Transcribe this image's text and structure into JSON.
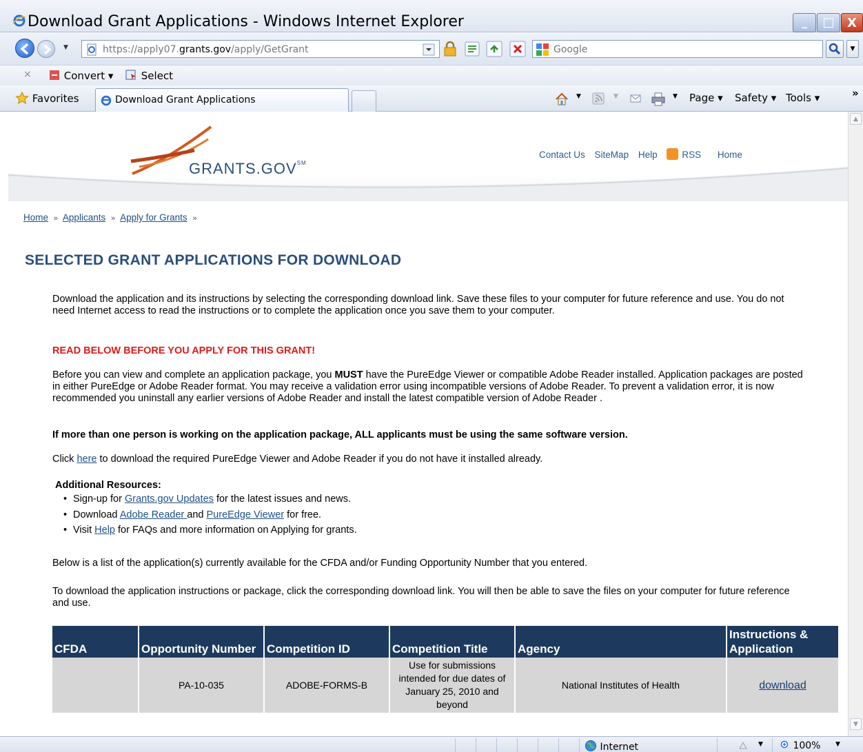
{
  "window": {
    "title": "Download Grant Applications - Windows Internet Explorer",
    "min_label": "_",
    "max_label": "□",
    "close_label": "X"
  },
  "address": {
    "url_prefix": "https://apply07.",
    "url_domain": "grants.gov",
    "url_path": "/apply/GetGrant",
    "search_placeholder": "Google"
  },
  "command_bar": {
    "close_label": "×",
    "convert_label": "Convert ▾",
    "select_label": "Select"
  },
  "favorites_bar": {
    "favorites_label": "Favorites",
    "tab_label": "Download Grant Applications",
    "page_menu": "Page ▾",
    "safety_menu": "Safety ▾",
    "tools_menu": "Tools ▾",
    "overflow": "»"
  },
  "site": {
    "logo_text": "GRANTS.GOV",
    "logo_sm": "SM",
    "top_links": [
      "Contact Us",
      "SiteMap",
      "Help",
      "RSS",
      "Home"
    ],
    "breadcrumb": [
      "Home",
      "Applicants",
      "Apply for Grants"
    ],
    "breadcrumb_sep": "»",
    "page_title": "SELECTED GRANT APPLICATIONS FOR DOWNLOAD"
  },
  "content": {
    "intro": "Download the application and its instructions by selecting the corresponding download link. Save these files to your computer for future reference and use. You do not need Internet access to read the instructions or to complete the application once you save them to your computer.",
    "warning": "READ BELOW BEFORE YOU APPLY FOR THIS GRANT!",
    "before_1": "Before you can view and complete an application package, you ",
    "before_must": "MUST",
    "before_2": " have the PureEdge Viewer or compatible Adobe Reader installed. Application packages are posted in either PureEdge or Adobe Reader format. You may receive a validation error using incompatible versions of Adobe Reader. To prevent a validation error, it is now recommended you uninstall any earlier versions of Adobe Reader and install the latest compatible version of Adobe Reader .",
    "bold_note": "If more than one person is working on the application package, ALL applicants must be using the same software version.",
    "click_1": "Click ",
    "click_link": "here",
    "click_2": " to download the required PureEdge Viewer and Adobe Reader if you do not have it installed already.",
    "resources_title": "Additional Resources:",
    "res1_a": "Sign-up for ",
    "res1_link": "Grants.gov Updates",
    "res1_b": " for the latest issues and news.",
    "res2_a": "Download ",
    "res2_link1": "Adobe Reader ",
    "res2_mid": "and ",
    "res2_link2": "PureEdge Viewer",
    "res2_b": " for free.",
    "res3_a": "Visit ",
    "res3_link": "Help",
    "res3_b": " for FAQs and more information on Applying for grants.",
    "below": "Below is a list of the application(s) currently available for the CFDA and/or Funding Opportunity Number that you entered.",
    "to_download": "To download the application instructions or package, click the corresponding download link. You will then be able to save the files on your computer for future reference and use."
  },
  "table": {
    "headers": [
      "CFDA",
      "Opportunity Number",
      "Competition ID",
      "Competition Title",
      "Agency",
      "Instructions & Application"
    ],
    "rows": [
      {
        "cfda": "",
        "opportunity": "PA-10-035",
        "competition_id": "ADOBE-FORMS-B",
        "competition_title": "Use for submissions intended for due dates of January 25, 2010 and beyond",
        "agency": "National Institutes of Health",
        "link": "download"
      }
    ]
  },
  "status": {
    "zone": "Internet",
    "zoom": "100%"
  },
  "colors": {
    "title_blue": "#2b4e7d",
    "link_blue": "#1f4f8a",
    "warning_red": "#e01a1a",
    "table_header": "#1d3a5e",
    "table_row": "#d6d6d6"
  }
}
